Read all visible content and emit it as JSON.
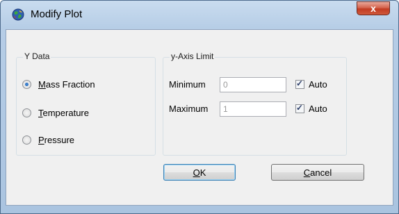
{
  "window": {
    "title": "Modify Plot",
    "close_label": "x"
  },
  "icons": {
    "app": "globe-icon",
    "close": "close-icon"
  },
  "y_data": {
    "label": "Y Data",
    "options": [
      {
        "accel": "M",
        "rest": "ass Fraction",
        "checked": true
      },
      {
        "accel": "T",
        "rest": "emperature",
        "checked": false
      },
      {
        "accel": "P",
        "rest": "ressure",
        "checked": false
      }
    ]
  },
  "y_axis_limit": {
    "label": "y-Axis Limit",
    "minimum": {
      "label": "Minimum",
      "value": "0",
      "auto_label": "Auto",
      "auto_checked": true
    },
    "maximum": {
      "label": "Maximum",
      "value": "1",
      "auto_label": "Auto",
      "auto_checked": true
    }
  },
  "buttons": {
    "ok": {
      "accel": "O",
      "rest": "K"
    },
    "cancel": {
      "accel": "C",
      "rest": "ancel"
    }
  },
  "colors": {
    "title_bar": "#b6cde6",
    "close_button": "#c23c22",
    "client_bg": "#f0f0f0"
  }
}
